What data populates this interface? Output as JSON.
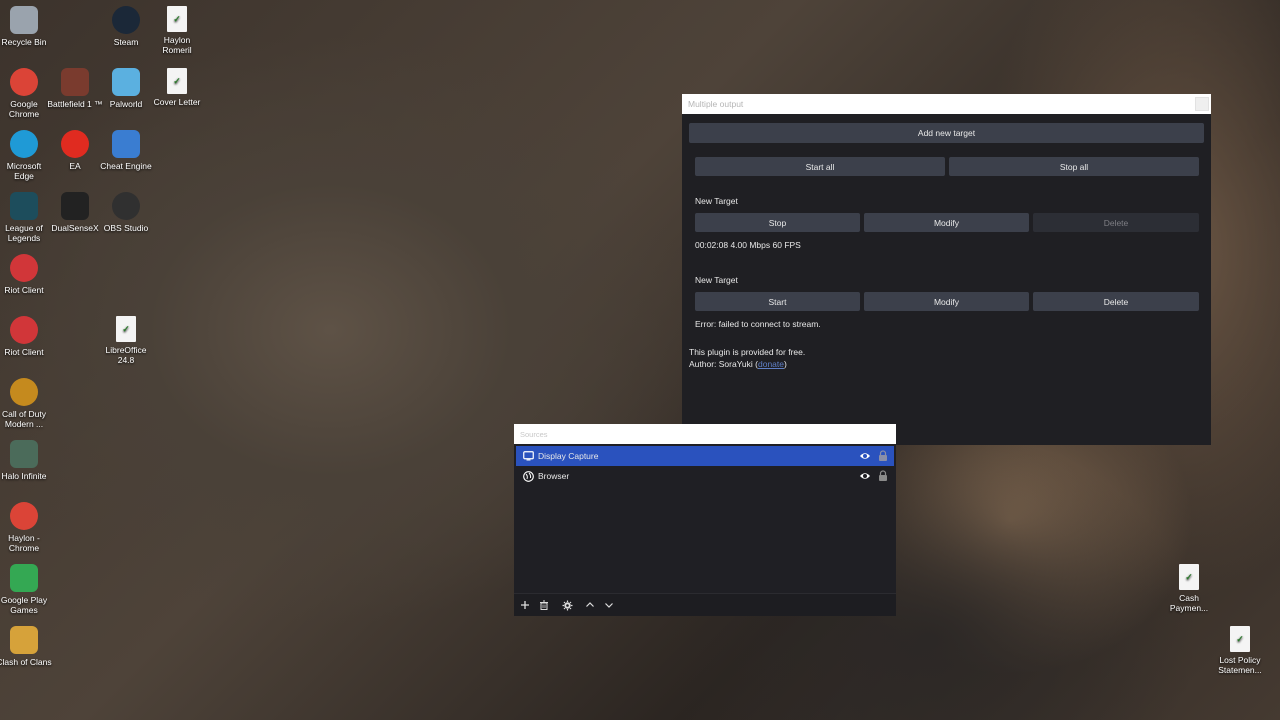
{
  "desktop": {
    "icons": [
      {
        "label": "Recycle Bin",
        "icon": "recycle-bin-icon",
        "color": "#9aa3ad"
      },
      {
        "label": "Steam",
        "icon": "steam-icon",
        "color": "#1b2838"
      },
      {
        "label": "Haylon Romeril",
        "icon": "document-icon",
        "color": "#f4f4f4"
      },
      {
        "label": "Google Chrome",
        "icon": "chrome-icon",
        "color": "#db4437"
      },
      {
        "label": "Battlefield 1 ™",
        "icon": "battlefield-icon",
        "color": "#7a3b2e"
      },
      {
        "label": "Palworld",
        "icon": "palworld-icon",
        "color": "#5bb0e0"
      },
      {
        "label": "Cover Letter",
        "icon": "document-icon",
        "color": "#f4f4f4"
      },
      {
        "label": "Microsoft Edge",
        "icon": "edge-icon",
        "color": "#1f9ad6"
      },
      {
        "label": "EA",
        "icon": "ea-icon",
        "color": "#e02b20"
      },
      {
        "label": "Cheat Engine",
        "icon": "cheat-engine-icon",
        "color": "#3a7dd1"
      },
      {
        "label": "League of Legends",
        "icon": "league-icon",
        "color": "#1d4d5c"
      },
      {
        "label": "DualSenseX",
        "icon": "dualsensex-icon",
        "color": "#222222"
      },
      {
        "label": "OBS Studio",
        "icon": "obs-icon",
        "color": "#303030"
      },
      {
        "label": "Riot Client",
        "icon": "riot-icon",
        "color": "#d13639"
      },
      {
        "label": "Riot Client",
        "icon": "riot-icon",
        "color": "#d13639"
      },
      {
        "label": "LibreOffice 24.8",
        "icon": "libreoffice-icon",
        "color": "#f4f4f4"
      },
      {
        "label": "Call of Duty Modern ...",
        "icon": "cod-icon",
        "color": "#c58a1e"
      },
      {
        "label": "Halo Infinite",
        "icon": "halo-icon",
        "color": "#4b6b5a"
      },
      {
        "label": "Haylon - Chrome",
        "icon": "chrome-icon",
        "color": "#db4437"
      },
      {
        "label": "Google Play Games",
        "icon": "play-games-icon",
        "color": "#34a853"
      },
      {
        "label": "Clash of Clans",
        "icon": "clash-icon",
        "color": "#d6a23a"
      },
      {
        "label": "Cash Paymen...",
        "icon": "document-icon",
        "color": "#f4f4f4"
      },
      {
        "label": "Lost Policy Statemen...",
        "icon": "document-icon",
        "color": "#f4f4f4"
      }
    ]
  },
  "multiple_output": {
    "title": "Multiple output",
    "add_new_target": "Add new target",
    "start_all": "Start all",
    "stop_all": "Stop all",
    "targets": [
      {
        "name": "New Target",
        "primary": "Stop",
        "modify": "Modify",
        "delete": "Delete",
        "status": "00:02:08  4.00 Mbps  60 FPS"
      },
      {
        "name": "New Target",
        "primary": "Start",
        "modify": "Modify",
        "delete": "Delete",
        "status": "Error: failed to connect to stream."
      }
    ],
    "footer_line1": "This plugin is provided for free.",
    "footer_author": "Author: SoraYuki (",
    "footer_link": "donate",
    "footer_close": ")"
  },
  "sources": {
    "title": "Sources",
    "items": [
      {
        "label": "Display Capture",
        "icon": "monitor-icon",
        "selected": true
      },
      {
        "label": "Browser",
        "icon": "globe-icon",
        "selected": false
      }
    ]
  },
  "colors": {
    "accent": "#2a52be",
    "window_bg": "#1f1f23",
    "button_bg": "#3c404b",
    "link": "#5f7fc6"
  }
}
